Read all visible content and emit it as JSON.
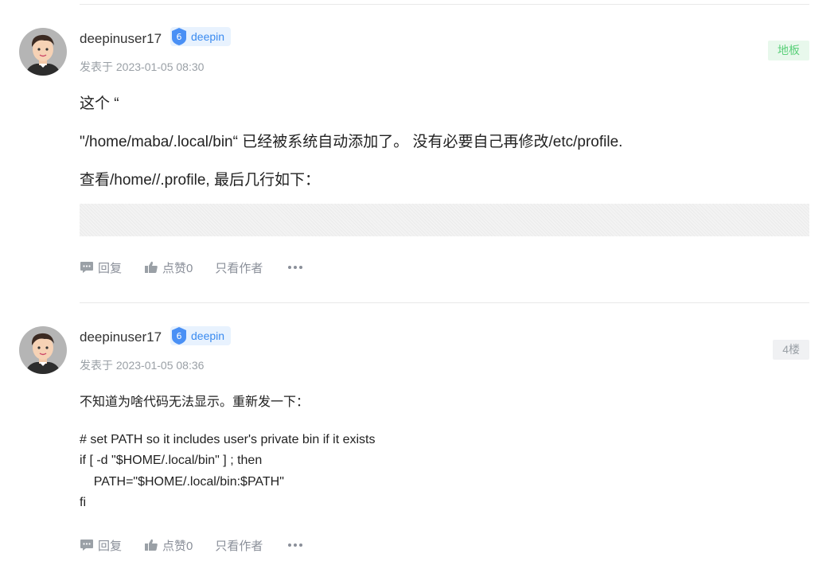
{
  "posts": [
    {
      "username": "deepinuser17",
      "badge_num": "6",
      "badge_label": "deepin",
      "post_time": "发表于 2023-01-05 08:30",
      "floor": "地板",
      "paragraphs": [
        "这个 “",
        "\"/home/maba/.local/bin“ 已经被系统自动添加了。 没有必要自己再修改/etc/profile.",
        "查看/home//.profile, 最后几行如下："
      ],
      "actions": {
        "reply": "回复",
        "like": "点赞0",
        "author_only": "只看作者"
      }
    },
    {
      "username": "deepinuser17",
      "badge_num": "6",
      "badge_label": "deepin",
      "post_time": "发表于 2023-01-05 08:36",
      "floor": "4楼",
      "lines": [
        "不知道为啥代码无法显示。重新发一下：",
        "",
        "# set PATH so it includes user's private bin if it exists",
        "if [ -d \"$HOME/.local/bin\" ] ; then",
        "    PATH=\"$HOME/.local/bin:$PATH\"",
        "fi"
      ],
      "actions": {
        "reply": "回复",
        "like": "点赞0",
        "author_only": "只看作者"
      }
    }
  ],
  "colors": {
    "badge_blue": "#3a8bf0",
    "floor_green": "#5bd07a",
    "muted": "#9aa0a6"
  }
}
